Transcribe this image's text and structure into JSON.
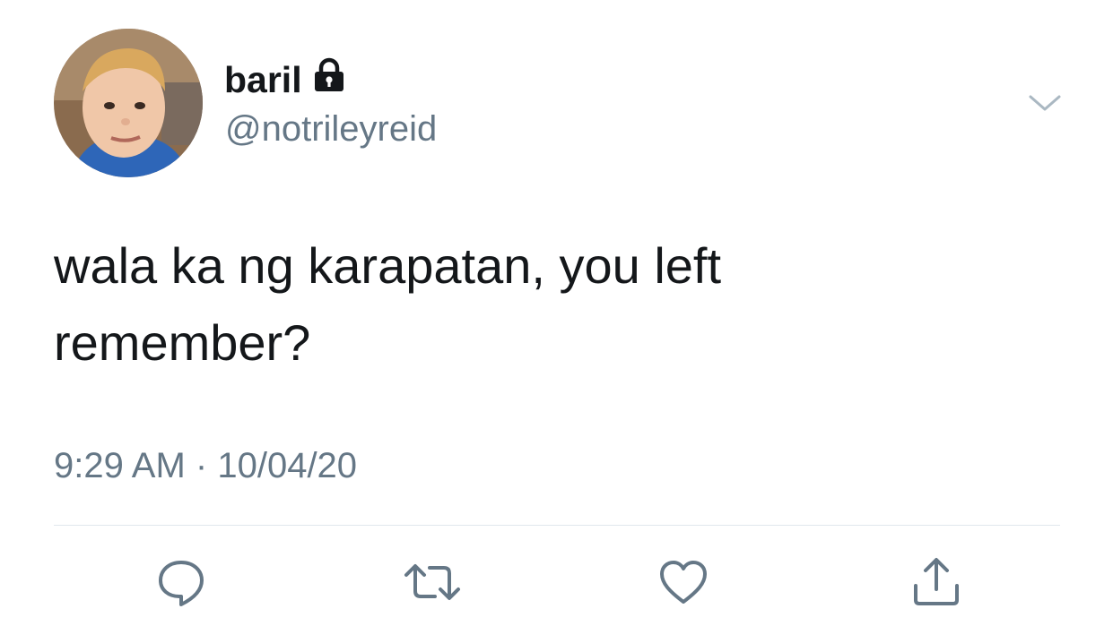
{
  "tweet": {
    "author": {
      "display_name": "baril",
      "handle": "@notrileyreid",
      "protected_icon": "lock-icon",
      "avatar": "profile-photo"
    },
    "menu_icon": "chevron-down-icon",
    "text": "wala ka ng karapatan, you left\nremember?",
    "time": "9:29 AM",
    "separator": "·",
    "date": "10/04/20"
  },
  "actions": [
    {
      "name": "reply",
      "icon": "reply-icon"
    },
    {
      "name": "retweet",
      "icon": "retweet-icon"
    },
    {
      "name": "like",
      "icon": "heart-icon"
    },
    {
      "name": "share",
      "icon": "share-icon"
    }
  ],
  "colors": {
    "text_primary": "#14171a",
    "text_secondary": "#657786",
    "icon": "#657786",
    "divider": "#e1e8ed",
    "background": "#ffffff"
  }
}
